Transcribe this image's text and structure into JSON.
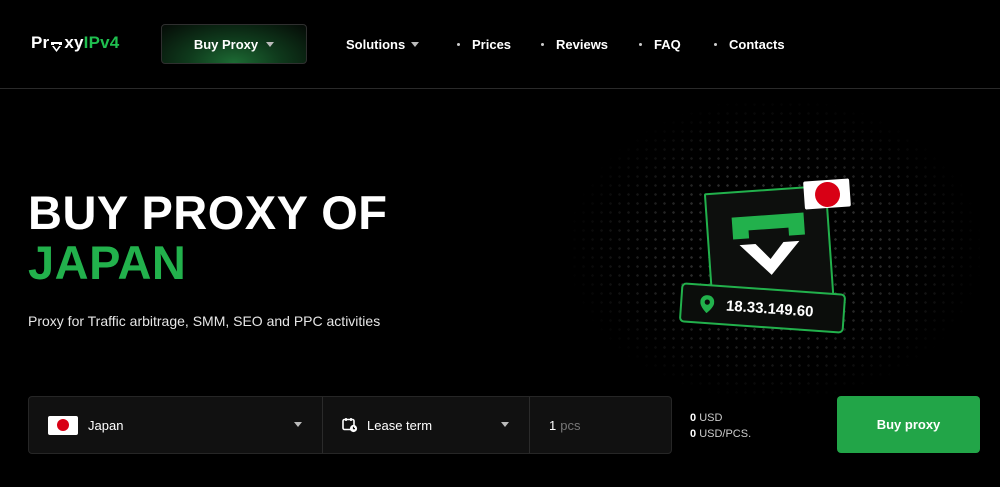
{
  "header": {
    "logo": {
      "part1": "Pr",
      "part2": "xy",
      "part3": "IPv4"
    },
    "buy_proxy_label": "Buy Proxy",
    "nav": [
      {
        "label": "Solutions",
        "dropdown": true
      },
      {
        "label": "Prices"
      },
      {
        "label": "Reviews"
      },
      {
        "label": "FAQ"
      },
      {
        "label": "Contacts"
      }
    ]
  },
  "hero": {
    "title_line1": "BUY PROXY OF",
    "title_line2": "JAPAN",
    "subtitle": "Proxy for Traffic arbitrage, SMM, SEO and PPC activities",
    "ip_address": "18.33.149.60"
  },
  "order": {
    "country": "Japan",
    "lease_term": "Lease term",
    "quantity": "1",
    "quantity_unit": "pcs",
    "total_value": "0",
    "total_unit": "USD",
    "per_piece_value": "0",
    "per_piece_unit": "USD/PCS.",
    "buy_label": "Buy proxy"
  },
  "colors": {
    "accent": "#22b14c",
    "background": "#000000",
    "flag_red": "#d80015"
  },
  "icons": [
    "shield-logo-icon",
    "chevron-down-icon",
    "location-pin-icon",
    "calendar-clock-icon",
    "japan-flag-icon"
  ]
}
